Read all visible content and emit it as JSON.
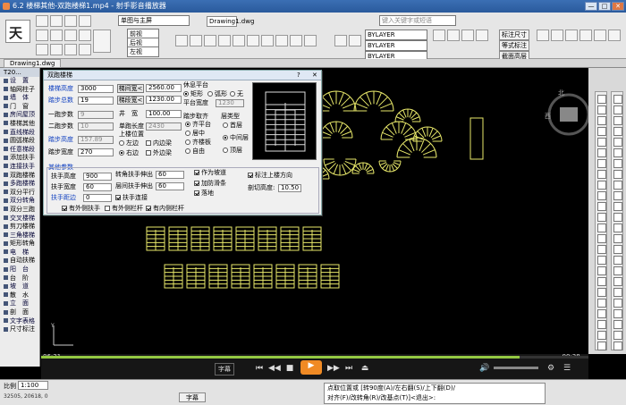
{
  "window": {
    "title": "6.2 楼梯其他-双跑楼梯1.mp4 - 射手影音播放器",
    "min": "—",
    "max": "□",
    "close": "✕"
  },
  "toolbar": {
    "combo_view": "单图与主屏",
    "drawing_name": "Drawing1.dwg",
    "search_placeholder": "键入关键字或短语",
    "view_items": [
      "前视",
      "后视",
      "左视"
    ],
    "layers": [
      "BYLAYER",
      "BYLAYER",
      "BYLAYER"
    ],
    "right_buttons": [
      "标注尺寸",
      "等式标注",
      "截面高层"
    ]
  },
  "doctab": "Drawing1.dwg",
  "leftpanel": {
    "header": "T20...",
    "items": [
      "设　置",
      "轴网柱子",
      "墙　体",
      "门　窗",
      "房间屋顶",
      "楼梯其他",
      "直线梯段",
      "圆弧梯段",
      "任意梯段",
      "添加扶手",
      "连接扶手",
      "双跑楼梯",
      "多跑楼梯",
      "双分平行",
      "双分转角",
      "双分三跑",
      "交叉楼梯",
      "剪刀楼梯",
      "三角楼梯",
      "矩形转角",
      "电　梯",
      "自动扶梯",
      "阳　台",
      "台　阶",
      "坡　道",
      "散　水",
      "立　面",
      "剖　面",
      "文字表格",
      "尺寸标注"
    ]
  },
  "dialog": {
    "title": "双跑楼梯",
    "help": "?",
    "close": "✕",
    "stair_height_label": "楼梯高度",
    "stair_height": "3000",
    "step_count_label": "踏步总数",
    "step_count": "19",
    "first_run_label": "一跑步数",
    "first_run": "9",
    "second_run_label": "二跑步数",
    "second_run": "10",
    "step_height_label": "踏步高度",
    "step_height": "157.89",
    "step_width_label": "踏步宽度",
    "step_width": "270",
    "btn_width": "梯间宽<",
    "width_val": "2560.00",
    "btn_segment": "梯段宽<",
    "segment_val": "1230.00",
    "well_width_label": "井　宽",
    "well_width": "100.00",
    "single_length_label": "单跑长度",
    "single_length": "2430",
    "landing_pos_label": "上楼位置",
    "pos_left": "左边",
    "pos_right": "右边",
    "inner_edge": "内边梁",
    "outer_edge": "外边梁",
    "rest_label": "休息平台",
    "rest_rect": "矩形",
    "rest_arc": "弧形",
    "rest_none": "无",
    "platform_width_label": "平台宽度",
    "platform_width": "1230",
    "tread_align_label": "踏步取齐",
    "align_platform": "齐平台",
    "align_center": "居中",
    "align_step": "齐楼板",
    "align_free": "自由",
    "floor_type_label": "层类型",
    "floor_first": "首层",
    "floor_middle": "中间层",
    "floor_top": "顶层",
    "other_params_label": "其他参数",
    "rail_height_label": "扶手高度",
    "rail_height": "900",
    "rail_width_label": "扶手宽度",
    "rail_width": "60",
    "rail_gap_label": "扶手距边",
    "rail_gap": "0",
    "corner_ext_label": "转角扶手伸出",
    "corner_ext": "60",
    "floor_ext_label": "层间扶手伸出",
    "floor_ext": "60",
    "rail_connect": "扶手连接",
    "as_slope": "作为坡道",
    "add_anti": "加防滑条",
    "landing": "落地",
    "mark_dir": "标注上楼方向",
    "cut_height_label": "剖切高度:",
    "cut_height": "10.50",
    "inner_rail": "有外侧扶手",
    "outer_rail": "有外侧栏杆",
    "inner_post": "有内侧栏杆"
  },
  "player": {
    "time_current": "06:31",
    "time_total": "-00:38",
    "subtitle_btn": "字幕",
    "progress": 0.874
  },
  "statusbar": {
    "scale_label": "比例",
    "scale_value": "1:100",
    "coords": "32505, 20618, 0",
    "cmd_line1": "点取位置或 [转90度(A)/左右翻(S)/上下翻(D)/",
    "cmd_line2": "对齐(F)/改转角(R)/改基点(T)]<退出>:"
  },
  "colors": {
    "accent_blue": "#2a5a9c",
    "cad_yellow": "#e8e86a",
    "progress_green": "#93c842",
    "play_orange": "#f08a24"
  }
}
